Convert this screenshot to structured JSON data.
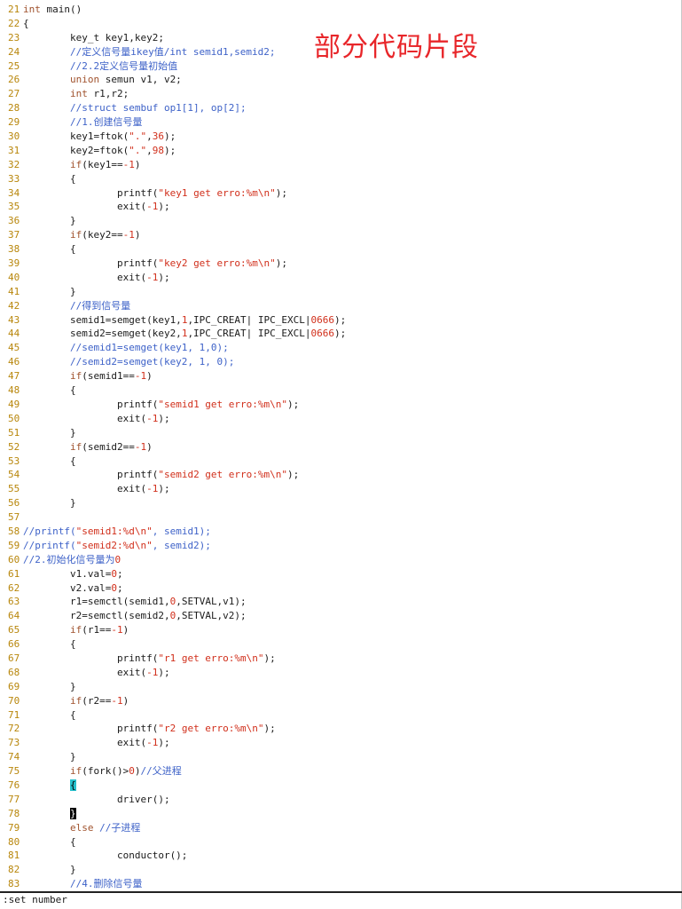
{
  "overlay_title": "部分代码片段",
  "command_line": ":set number",
  "lines": [
    {
      "n": "21",
      "segs": [
        [
          "kw",
          "int"
        ],
        [
          "plain",
          " main()"
        ]
      ]
    },
    {
      "n": "22",
      "segs": [
        [
          "plain",
          "{"
        ]
      ]
    },
    {
      "n": "23",
      "segs": [
        [
          "plain",
          "        key_t key1,key2;"
        ]
      ]
    },
    {
      "n": "24",
      "segs": [
        [
          "cmt",
          "        //定义信号量ikey值/int semid1,semid2;"
        ]
      ]
    },
    {
      "n": "25",
      "segs": [
        [
          "cmt",
          "        //2.2定义信号量初始值"
        ]
      ]
    },
    {
      "n": "26",
      "segs": [
        [
          "kw",
          "        union"
        ],
        [
          "plain",
          " semun v1, v2;"
        ]
      ]
    },
    {
      "n": "27",
      "segs": [
        [
          "kw",
          "        int"
        ],
        [
          "plain",
          " r1,r2;"
        ]
      ]
    },
    {
      "n": "28",
      "segs": [
        [
          "cmt",
          "        //struct sembuf op1[1], op[2];"
        ]
      ]
    },
    {
      "n": "29",
      "segs": [
        [
          "cmt",
          "        //1.创建信号量"
        ]
      ]
    },
    {
      "n": "30",
      "segs": [
        [
          "plain",
          "        key1=ftok("
        ],
        [
          "str",
          "\".\""
        ],
        [
          "plain",
          ","
        ],
        [
          "num",
          "36"
        ],
        [
          "plain",
          ");"
        ]
      ]
    },
    {
      "n": "31",
      "segs": [
        [
          "plain",
          "        key2=ftok("
        ],
        [
          "str",
          "\".\""
        ],
        [
          "plain",
          ","
        ],
        [
          "num",
          "98"
        ],
        [
          "plain",
          ");"
        ]
      ]
    },
    {
      "n": "32",
      "segs": [
        [
          "kw",
          "        if"
        ],
        [
          "plain",
          "(key1=="
        ],
        [
          "num",
          "-1"
        ],
        [
          "plain",
          ")"
        ]
      ]
    },
    {
      "n": "33",
      "segs": [
        [
          "plain",
          "        {"
        ]
      ]
    },
    {
      "n": "34",
      "segs": [
        [
          "plain",
          "                printf("
        ],
        [
          "str",
          "\"key1 get erro:%m\\n\""
        ],
        [
          "plain",
          ");"
        ]
      ]
    },
    {
      "n": "35",
      "segs": [
        [
          "plain",
          "                exit("
        ],
        [
          "num",
          "-1"
        ],
        [
          "plain",
          ");"
        ]
      ]
    },
    {
      "n": "36",
      "segs": [
        [
          "plain",
          "        }"
        ]
      ]
    },
    {
      "n": "37",
      "segs": [
        [
          "kw",
          "        if"
        ],
        [
          "plain",
          "(key2=="
        ],
        [
          "num",
          "-1"
        ],
        [
          "plain",
          ")"
        ]
      ]
    },
    {
      "n": "38",
      "segs": [
        [
          "plain",
          "        {"
        ]
      ]
    },
    {
      "n": "39",
      "segs": [
        [
          "plain",
          "                printf("
        ],
        [
          "str",
          "\"key2 get erro:%m\\n\""
        ],
        [
          "plain",
          ");"
        ]
      ]
    },
    {
      "n": "40",
      "segs": [
        [
          "plain",
          "                exit("
        ],
        [
          "num",
          "-1"
        ],
        [
          "plain",
          ");"
        ]
      ]
    },
    {
      "n": "41",
      "segs": [
        [
          "plain",
          "        }"
        ]
      ]
    },
    {
      "n": "42",
      "segs": [
        [
          "cmt",
          "        //得到信号量"
        ]
      ]
    },
    {
      "n": "43",
      "segs": [
        [
          "plain",
          "        semid1=semget(key1,"
        ],
        [
          "num",
          "1"
        ],
        [
          "plain",
          ",IPC_CREAT| IPC_EXCL|"
        ],
        [
          "num",
          "0666"
        ],
        [
          "plain",
          ");"
        ]
      ]
    },
    {
      "n": "44",
      "segs": [
        [
          "plain",
          "        semid2=semget(key2,"
        ],
        [
          "num",
          "1"
        ],
        [
          "plain",
          ",IPC_CREAT| IPC_EXCL|"
        ],
        [
          "num",
          "0666"
        ],
        [
          "plain",
          ");"
        ]
      ]
    },
    {
      "n": "45",
      "segs": [
        [
          "cmt",
          "        //semid1=semget(key1, 1,0);"
        ]
      ]
    },
    {
      "n": "46",
      "segs": [
        [
          "cmt",
          "        //semid2=semget(key2, 1, 0);"
        ]
      ]
    },
    {
      "n": "47",
      "segs": [
        [
          "kw",
          "        if"
        ],
        [
          "plain",
          "(semid1=="
        ],
        [
          "num",
          "-1"
        ],
        [
          "plain",
          ")"
        ]
      ]
    },
    {
      "n": "48",
      "segs": [
        [
          "plain",
          "        {"
        ]
      ]
    },
    {
      "n": "49",
      "segs": [
        [
          "plain",
          "                printf("
        ],
        [
          "str",
          "\"semid1 get erro:%m\\n\""
        ],
        [
          "plain",
          ");"
        ]
      ]
    },
    {
      "n": "50",
      "segs": [
        [
          "plain",
          "                exit("
        ],
        [
          "num",
          "-1"
        ],
        [
          "plain",
          ");"
        ]
      ]
    },
    {
      "n": "51",
      "segs": [
        [
          "plain",
          "        }"
        ]
      ]
    },
    {
      "n": "52",
      "segs": [
        [
          "kw",
          "        if"
        ],
        [
          "plain",
          "(semid2=="
        ],
        [
          "num",
          "-1"
        ],
        [
          "plain",
          ")"
        ]
      ]
    },
    {
      "n": "53",
      "segs": [
        [
          "plain",
          "        {"
        ]
      ]
    },
    {
      "n": "54",
      "segs": [
        [
          "plain",
          "                printf("
        ],
        [
          "str",
          "\"semid2 get erro:%m\\n\""
        ],
        [
          "plain",
          ");"
        ]
      ]
    },
    {
      "n": "55",
      "segs": [
        [
          "plain",
          "                exit("
        ],
        [
          "num",
          "-1"
        ],
        [
          "plain",
          ");"
        ]
      ]
    },
    {
      "n": "56",
      "segs": [
        [
          "plain",
          "        }"
        ]
      ]
    },
    {
      "n": "57",
      "segs": []
    },
    {
      "n": "58",
      "segs": [
        [
          "cmt",
          "//printf("
        ],
        [
          "str",
          "\"semid1:%d\\n\""
        ],
        [
          "cmt",
          ", semid1);"
        ]
      ]
    },
    {
      "n": "59",
      "segs": [
        [
          "cmt",
          "//printf("
        ],
        [
          "str",
          "\"semid2:%d\\n\""
        ],
        [
          "cmt",
          ", semid2);"
        ]
      ]
    },
    {
      "n": "60",
      "segs": [
        [
          "cmt",
          "//2.初始化信号量为"
        ],
        [
          "num",
          "0"
        ]
      ]
    },
    {
      "n": "61",
      "segs": [
        [
          "plain",
          "        v1.val="
        ],
        [
          "num",
          "0"
        ],
        [
          "plain",
          ";"
        ]
      ]
    },
    {
      "n": "62",
      "segs": [
        [
          "plain",
          "        v2.val="
        ],
        [
          "num",
          "0"
        ],
        [
          "plain",
          ";"
        ]
      ]
    },
    {
      "n": "63",
      "segs": [
        [
          "plain",
          "        r1=semctl(semid1,"
        ],
        [
          "num",
          "0"
        ],
        [
          "plain",
          ",SETVAL,v1);"
        ]
      ]
    },
    {
      "n": "64",
      "segs": [
        [
          "plain",
          "        r2=semctl(semid2,"
        ],
        [
          "num",
          "0"
        ],
        [
          "plain",
          ",SETVAL,v2);"
        ]
      ]
    },
    {
      "n": "65",
      "segs": [
        [
          "kw",
          "        if"
        ],
        [
          "plain",
          "(r1=="
        ],
        [
          "num",
          "-1"
        ],
        [
          "plain",
          ")"
        ]
      ]
    },
    {
      "n": "66",
      "segs": [
        [
          "plain",
          "        {"
        ]
      ]
    },
    {
      "n": "67",
      "segs": [
        [
          "plain",
          "                printf("
        ],
        [
          "str",
          "\"r1 get erro:%m\\n\""
        ],
        [
          "plain",
          ");"
        ]
      ]
    },
    {
      "n": "68",
      "segs": [
        [
          "plain",
          "                exit("
        ],
        [
          "num",
          "-1"
        ],
        [
          "plain",
          ");"
        ]
      ]
    },
    {
      "n": "69",
      "segs": [
        [
          "plain",
          "        }"
        ]
      ]
    },
    {
      "n": "70",
      "segs": [
        [
          "kw",
          "        if"
        ],
        [
          "plain",
          "(r2=="
        ],
        [
          "num",
          "-1"
        ],
        [
          "plain",
          ")"
        ]
      ]
    },
    {
      "n": "71",
      "segs": [
        [
          "plain",
          "        {"
        ]
      ]
    },
    {
      "n": "72",
      "segs": [
        [
          "plain",
          "                printf("
        ],
        [
          "str",
          "\"r2 get erro:%m\\n\""
        ],
        [
          "plain",
          ");"
        ]
      ]
    },
    {
      "n": "73",
      "segs": [
        [
          "plain",
          "                exit("
        ],
        [
          "num",
          "-1"
        ],
        [
          "plain",
          ");"
        ]
      ]
    },
    {
      "n": "74",
      "segs": [
        [
          "plain",
          "        }"
        ]
      ]
    },
    {
      "n": "75",
      "segs": [
        [
          "kw",
          "        if"
        ],
        [
          "plain",
          "(fork()>"
        ],
        [
          "num",
          "0"
        ],
        [
          "plain",
          ")"
        ],
        [
          "cmt",
          "//父进程"
        ]
      ]
    },
    {
      "n": "76",
      "segs": [
        [
          "plain",
          "        "
        ],
        [
          "cur",
          "{"
        ]
      ]
    },
    {
      "n": "77",
      "segs": [
        [
          "plain",
          "                driver();"
        ]
      ]
    },
    {
      "n": "78",
      "segs": [
        [
          "plain",
          "        "
        ],
        [
          "curdark",
          "}"
        ]
      ]
    },
    {
      "n": "79",
      "segs": [
        [
          "kw",
          "        else"
        ],
        [
          "cmt",
          " //子进程"
        ]
      ]
    },
    {
      "n": "80",
      "segs": [
        [
          "plain",
          "        {"
        ]
      ]
    },
    {
      "n": "81",
      "segs": [
        [
          "plain",
          "                conductor();"
        ]
      ]
    },
    {
      "n": "82",
      "segs": [
        [
          "plain",
          "        }"
        ]
      ]
    },
    {
      "n": "83",
      "segs": [
        [
          "cmt",
          "        //4.删除信号量"
        ]
      ]
    }
  ]
}
